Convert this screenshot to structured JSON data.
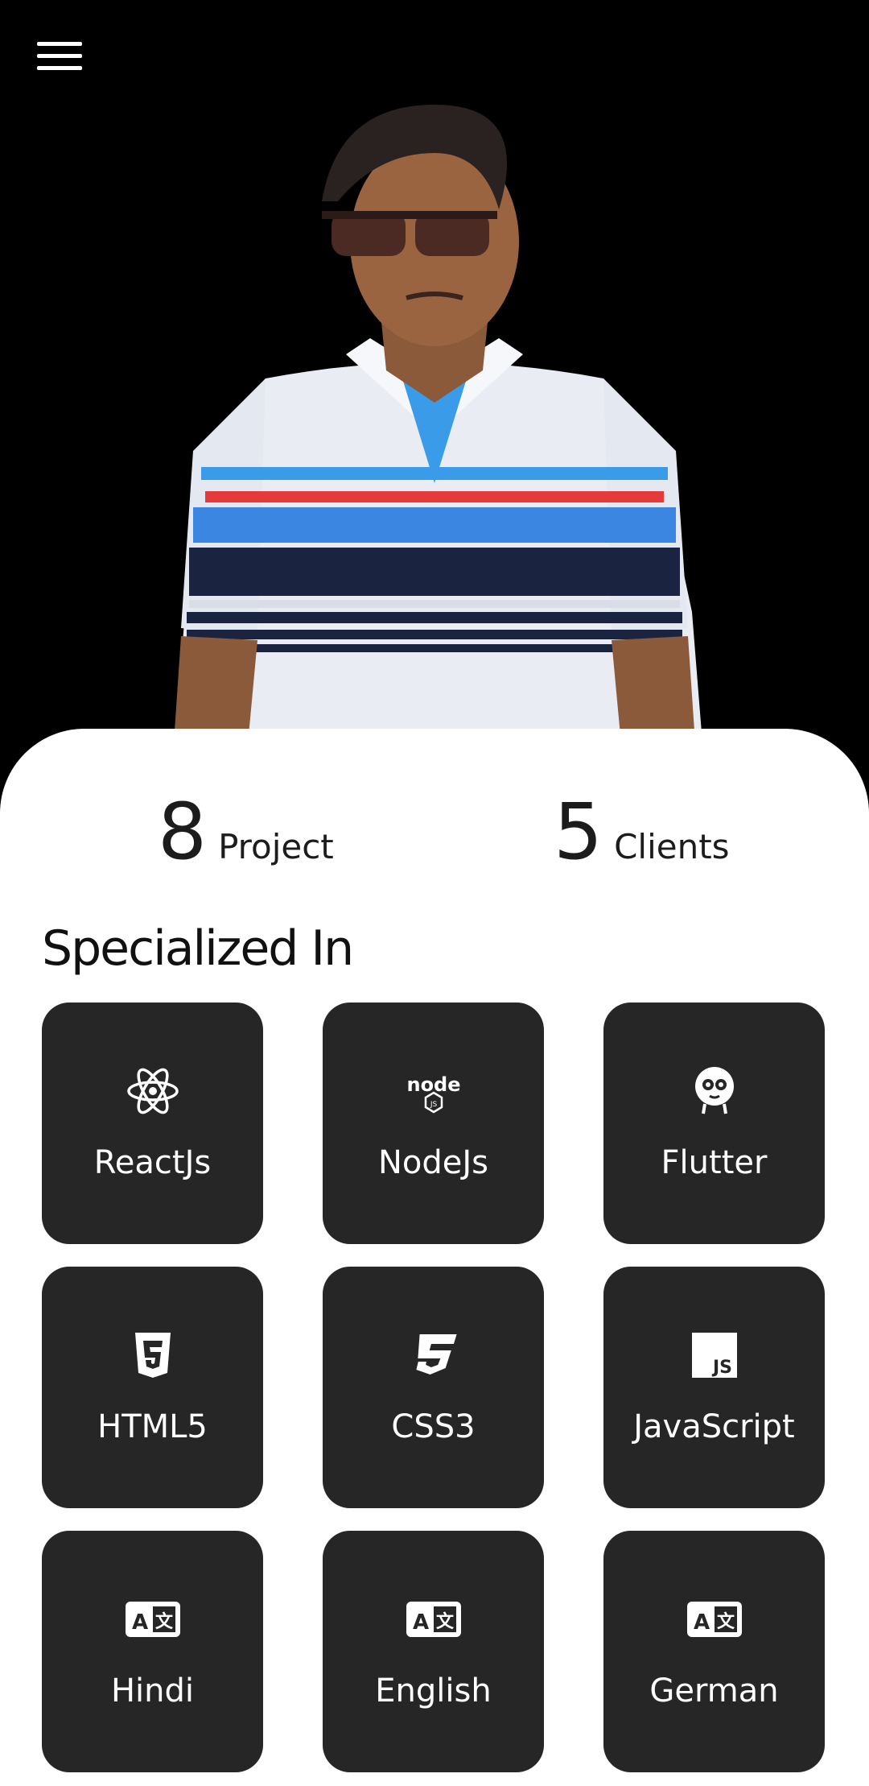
{
  "header": {
    "menu_icon": "hamburger-menu-icon"
  },
  "stats": [
    {
      "value": "8",
      "label": "Project"
    },
    {
      "value": "5",
      "label": "Clients"
    }
  ],
  "section": {
    "title": "Specialized In"
  },
  "skills": [
    {
      "label": "ReactJs",
      "icon": "react-icon"
    },
    {
      "label": "NodeJs",
      "icon": "nodejs-icon"
    },
    {
      "label": "Flutter",
      "icon": "flutter-icon"
    },
    {
      "label": "HTML5",
      "icon": "html5-icon"
    },
    {
      "label": "CSS3",
      "icon": "css3-icon"
    },
    {
      "label": "JavaScript",
      "icon": "javascript-icon"
    },
    {
      "label": "Hindi",
      "icon": "translate-icon"
    },
    {
      "label": "English",
      "icon": "translate-icon"
    },
    {
      "label": "German",
      "icon": "translate-icon"
    }
  ],
  "colors": {
    "hero_bg": "#000000",
    "tile_bg": "#262626",
    "card_bg": "#ffffff",
    "text": "#1c1c1c"
  }
}
